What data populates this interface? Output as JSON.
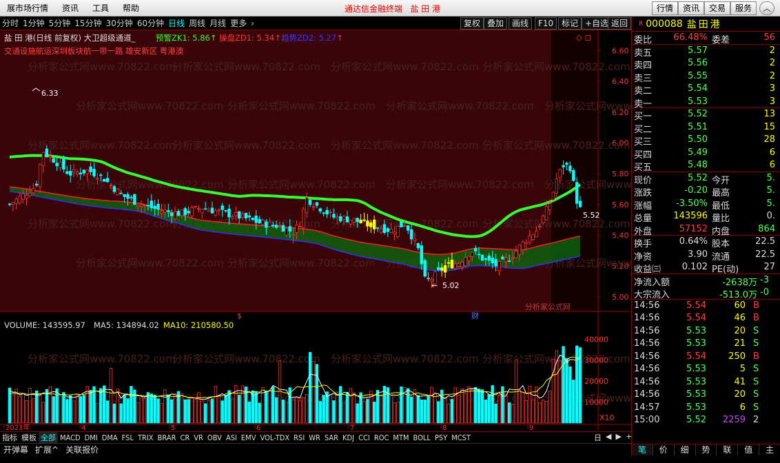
{
  "menu": {
    "items": [
      "展市场行情",
      "资讯",
      "工具",
      "帮助"
    ],
    "title": "通达信金融终端   盐 田 港",
    "right_buttons": [
      "行情",
      "资讯",
      "交易",
      "服务"
    ]
  },
  "periods": {
    "items": [
      "分时",
      "1分钟",
      "5分钟",
      "15分钟",
      "30分钟",
      "60分钟",
      "日线",
      "周线",
      "月线",
      "更多",
      "›"
    ],
    "active": "日线",
    "right_buttons": [
      "复权",
      "叠加",
      "画线",
      "F10",
      "标记",
      "+自选",
      "返回"
    ]
  },
  "colors": {
    "up": "#ff3232",
    "down": "#00ffff",
    "ma_green": "#33ff33",
    "yellow": "#ffff00",
    "blue": "#3030ff",
    "red_band": "#ff2020",
    "price_up": "#ff5555",
    "price_down": "#55ff55"
  },
  "main_chart": {
    "title_line": "盐 田 港(日线 前复权) 大卫超级通道_",
    "indicators": [
      {
        "label": "预警ZK1: 5.86",
        "color": "#33ff33"
      },
      {
        "label": "操盘ZD1: 5.34",
        "color": "#ff3333"
      },
      {
        "label": "趋势ZD2: 5.27",
        "color": "#3b3bff"
      }
    ],
    "concepts": "交通设施航运深圳板块航一带一路 雄安新区 粤港澳",
    "watermark": "分析家公式网www.70822.com",
    "watermark_small": "分析家公式网",
    "hi_label": "6.33",
    "lo_label": "5.02",
    "last_label": "5.52",
    "marker_s": "$",
    "marker_cai": "财",
    "price_axis": [
      "6.60",
      "6.40",
      "6.20",
      "6.00",
      "5.80",
      "5.60",
      "5.40",
      "5.20",
      "5.00"
    ],
    "diamond_icon": "◇ ◻"
  },
  "volume_chart": {
    "label": "VOLUME: 143595.97",
    "ma5": "MA5: 134894.02",
    "ma10": "MA10: 210580.50",
    "axis": [
      "40000",
      "30000",
      "20000",
      "10000"
    ],
    "unit": "X10",
    "months": [
      "2021年",
      "4",
      "5",
      "6",
      "7",
      "8",
      "9"
    ]
  },
  "bottom_tabs": [
    "指标",
    "模板",
    "全部",
    "MACD",
    "DMI",
    "DMA",
    "FSL",
    "TRIX",
    "BRAR",
    "CR",
    "VR",
    "OBV",
    "ASI",
    "EMV",
    "VOL-TDX",
    "RSI",
    "WR",
    "SAR",
    "KDJ",
    "CCI",
    "ROC",
    "MTM",
    "BOLL",
    "PSY",
    "MCST"
  ],
  "bottom_active": "全部",
  "bottom_right": {
    "label": "日线",
    "nav": [
      "◀",
      "▶",
      "+",
      "-",
      "0"
    ]
  },
  "bottom_bar2": [
    "开弹幕",
    "扩展^",
    "关联报价"
  ],
  "quote": {
    "badge": "R",
    "code": "000088",
    "name": "盐田港",
    "weibi_label": "委比",
    "weibi_val": "66.48%",
    "weicha_label": "委差",
    "weicha_val": "56",
    "asks": [
      {
        "l": "卖五",
        "p": "5.57",
        "v": "2"
      },
      {
        "l": "卖四",
        "p": "5.56",
        "v": "2"
      },
      {
        "l": "卖三",
        "p": "5.55",
        "v": "2"
      },
      {
        "l": "卖二",
        "p": "5.54",
        "v": "3"
      },
      {
        "l": "卖一",
        "p": "5.53",
        "v": "3"
      }
    ],
    "bids": [
      {
        "l": "买一",
        "p": "5.52",
        "v": "13"
      },
      {
        "l": "买二",
        "p": "5.51",
        "v": "15"
      },
      {
        "l": "买三",
        "p": "5.50",
        "v": "28"
      },
      {
        "l": "买四",
        "p": "5.49",
        "v": "6"
      },
      {
        "l": "买五",
        "p": "5.48",
        "v": "6"
      }
    ],
    "stats": [
      {
        "l1": "现价",
        "v1": "5.52",
        "c1": "#55ff55",
        "l2": "今开",
        "v2": "5.",
        "c2": "#55ff55"
      },
      {
        "l1": "涨跌",
        "v1": "-0.20",
        "c1": "#55ff55",
        "l2": "最高",
        "v2": "5.",
        "c2": "#55ff55"
      },
      {
        "l1": "涨幅",
        "v1": "-3.50%",
        "c1": "#55ff55",
        "l2": "最低",
        "v2": "5.",
        "c2": "#55ff55"
      },
      {
        "l1": "总量",
        "v1": "143596",
        "c1": "#ffff00",
        "l2": "量比",
        "v2": "0.",
        "c2": "#ddd"
      },
      {
        "l1": "外盘",
        "v1": "57152",
        "c1": "#ff4040",
        "l2": "内盘",
        "v2": "864",
        "c2": "#55ff55"
      }
    ],
    "stats2": [
      {
        "l1": "换手",
        "v1": "0.64%",
        "c1": "#ddd",
        "l2": "股本",
        "v2": "22.5",
        "c2": "#ddd"
      },
      {
        "l1": "净资",
        "v1": "3.90",
        "c1": "#ddd",
        "l2": "流通",
        "v2": "22.5",
        "c2": "#ddd"
      },
      {
        "l1": "收益㈢",
        "v1": "0.102",
        "c1": "#ddd",
        "l2": "PE(动)",
        "v2": "27",
        "c2": "#ddd"
      }
    ],
    "flows": [
      {
        "l": "净流入额",
        "v": "-2638万",
        "v2": "-3"
      },
      {
        "l": "大宗流入",
        "v": "-513.0万",
        "v2": "-0"
      }
    ],
    "ticks": [
      {
        "t": "14:56",
        "p": "5.54",
        "v": "60",
        "f": "B"
      },
      {
        "t": "14:56",
        "p": "5.54",
        "v": "46",
        "f": "B"
      },
      {
        "t": "14:56",
        "p": "5.53",
        "v": "20",
        "f": "S"
      },
      {
        "t": "14:56",
        "p": "5.53",
        "v": "21",
        "f": "S"
      },
      {
        "t": "14:56",
        "p": "5.54",
        "v": "250",
        "f": "B"
      },
      {
        "t": "14:56",
        "p": "5.53",
        "v": "5",
        "f": "S"
      },
      {
        "t": "14:56",
        "p": "5.53",
        "v": "41",
        "f": "S"
      },
      {
        "t": "14:56",
        "p": "5.53",
        "v": "20",
        "f": "S"
      },
      {
        "t": "14:57",
        "p": "5.53",
        "v": "6",
        "f": "S"
      },
      {
        "t": "15:00",
        "p": "5.52",
        "v": "2259",
        "f": "2"
      }
    ],
    "tabs": [
      "笔",
      "价",
      "细",
      "势",
      "联",
      "值",
      "主"
    ],
    "tab_active": "笔"
  }
}
